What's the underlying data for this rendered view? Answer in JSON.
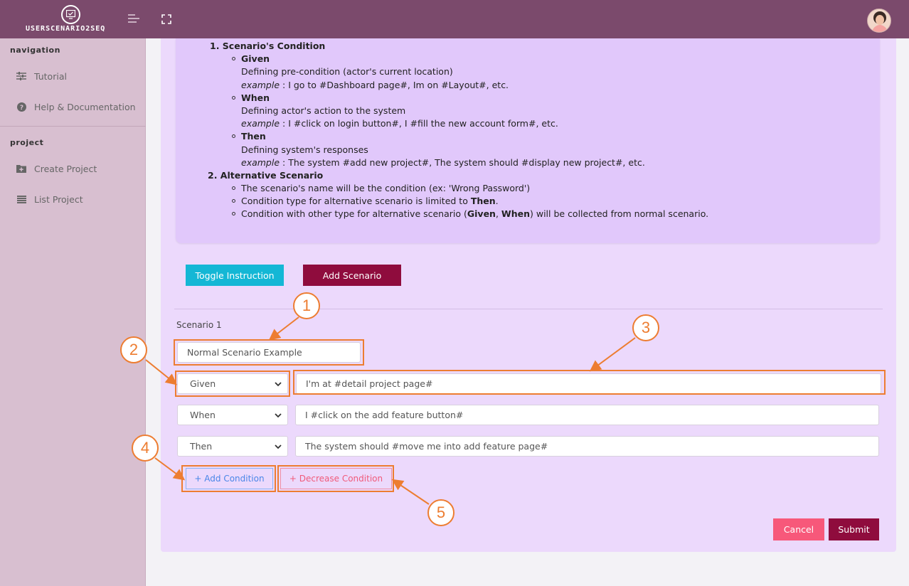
{
  "app": {
    "brand_name": "USERSCENARIO2SEQ"
  },
  "header": {
    "menu_icon": "hamburger-icon",
    "fullscreen_icon": "fullscreen-icon",
    "avatar_icon": "user-avatar"
  },
  "sidebar": {
    "navigation_heading": "navigation",
    "navigation_items": [
      {
        "label": "Tutorial",
        "icon": "sliders-icon"
      },
      {
        "label": "Help & Documentation",
        "icon": "question-circle-icon"
      }
    ],
    "project_heading": "project",
    "project_items": [
      {
        "label": "Create Project",
        "icon": "folder-plus-icon"
      },
      {
        "label": "List Project",
        "icon": "list-icon"
      }
    ]
  },
  "instructions": {
    "s1_title": "1. Scenario's Condition",
    "given_title": "Given",
    "given_desc": "Defining pre-condition (actor's current location)",
    "given_example_label": "example",
    "given_example_text": " : I go to #Dashboard page#, Im on #Layout#, etc.",
    "when_title": "When",
    "when_desc": "Defining actor's action to the system",
    "when_example_label": "example",
    "when_example_text": " : I #click on login button#, I #fill the new account form#, etc.",
    "then_title": "Then",
    "then_desc": "Defining system's responses",
    "then_example_label": "example",
    "then_example_text": " : The system #add new project#, The system should #display new project#, etc.",
    "s2_title": "2. Alternative Scenario",
    "alt_1": "The scenario's name will be the condition (ex: 'Wrong Password')",
    "alt_2_pre": "Condition type for alternative scenario is limited to ",
    "alt_2_bold": "Then",
    "alt_2_post": ".",
    "alt_3_pre": "Condition with other type for alternative scenario (",
    "alt_3_b1": "Given",
    "alt_3_mid": ", ",
    "alt_3_b2": "When",
    "alt_3_post": ") will be collected from normal scenario."
  },
  "actions": {
    "toggle_instruction": "Toggle Instruction",
    "add_scenario": "Add Scenario"
  },
  "scenario": {
    "label": "Scenario 1",
    "name_value": "Normal Scenario Example",
    "conditions": [
      {
        "type": "Given",
        "text": "I'm at #detail project page#"
      },
      {
        "type": "When",
        "text": "I #click on the add feature button#"
      },
      {
        "type": "Then",
        "text": "The system should #move me into add feature page#"
      }
    ],
    "add_condition": "+ Add Condition",
    "decrease_condition": "+ Decrease Condition"
  },
  "footer": {
    "cancel": "Cancel",
    "submit": "Submit"
  },
  "annotations": [
    "1",
    "2",
    "3",
    "4",
    "5"
  ],
  "colors": {
    "topbar": "#7b4a6c",
    "sidebar": "#d8bfd0",
    "card": "#ecd9fc",
    "accent_teal": "#14b7d5",
    "accent_maroon": "#8f0c3d",
    "cancel_pink": "#f7587a",
    "annotation_orange": "#ed7d31"
  }
}
